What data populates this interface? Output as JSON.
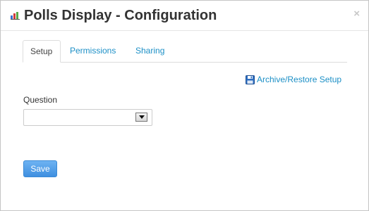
{
  "dialog": {
    "title": "Polls Display - Configuration",
    "app_icon": "bar-chart-icon",
    "close_label": "×"
  },
  "tabs": [
    {
      "label": "Setup",
      "active": true
    },
    {
      "label": "Permissions",
      "active": false
    },
    {
      "label": "Sharing",
      "active": false
    }
  ],
  "archive": {
    "label": "Archive/Restore Setup",
    "icon": "floppy-disk-icon"
  },
  "form": {
    "question_label": "Question",
    "question_value": ""
  },
  "actions": {
    "save_label": "Save"
  },
  "colors": {
    "link": "#1b8fc6",
    "button": "#4a96e4",
    "title": "#333333"
  }
}
